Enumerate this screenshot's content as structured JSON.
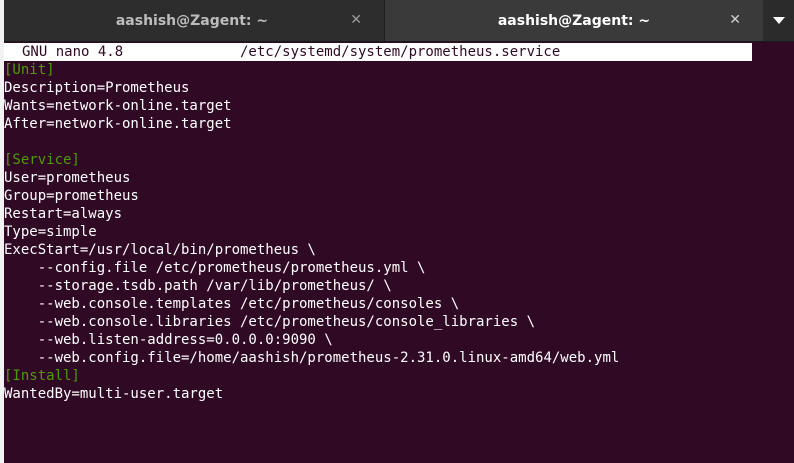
{
  "tabs": [
    {
      "title": "aashish@Zagent: ~",
      "close": "✕"
    },
    {
      "title": "aashish@Zagent: ~",
      "close": "✕"
    }
  ],
  "nano": {
    "version": "GNU nano 4.8",
    "file_path": "/etc/systemd/system/prometheus.service"
  },
  "file_lines": [
    {
      "text": "[Unit]",
      "type": "section"
    },
    {
      "text": "Description=Prometheus",
      "type": "text"
    },
    {
      "text": "Wants=network-online.target",
      "type": "text"
    },
    {
      "text": "After=network-online.target",
      "type": "text"
    },
    {
      "text": "",
      "type": "text"
    },
    {
      "text": "[Service]",
      "type": "section"
    },
    {
      "text": "User=prometheus",
      "type": "text"
    },
    {
      "text": "Group=prometheus",
      "type": "text"
    },
    {
      "text": "Restart=always",
      "type": "text"
    },
    {
      "text": "Type=simple",
      "type": "text"
    },
    {
      "text": "ExecStart=/usr/local/bin/prometheus \\",
      "type": "text"
    },
    {
      "text": "    --config.file /etc/prometheus/prometheus.yml \\",
      "type": "text"
    },
    {
      "text": "    --storage.tsdb.path /var/lib/prometheus/ \\",
      "type": "text"
    },
    {
      "text": "    --web.console.templates /etc/prometheus/consoles \\",
      "type": "text"
    },
    {
      "text": "    --web.console.libraries /etc/prometheus/console_libraries \\",
      "type": "text"
    },
    {
      "text": "    --web.listen-address=0.0.0.0:9090 \\",
      "type": "text"
    },
    {
      "text": "    --web.config.file=/home/aashish/prometheus-2.31.0.linux-amd64/web.yml",
      "type": "text"
    },
    {
      "text": "[Install]",
      "type": "section"
    },
    {
      "text": "WantedBy=multi-user.target",
      "type": "text"
    }
  ]
}
